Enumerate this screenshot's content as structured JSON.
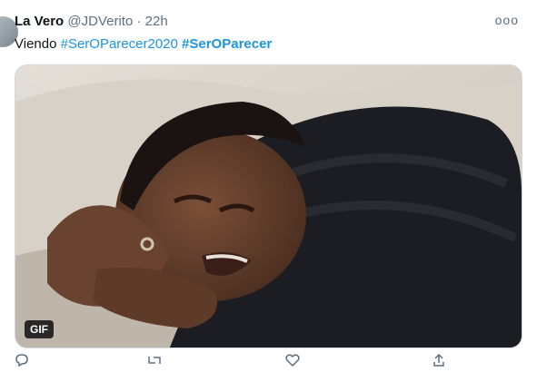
{
  "tweet": {
    "display_name": "La Vero",
    "handle": "@JDVerito",
    "separator": "·",
    "time": "22h",
    "more_label": "ooo",
    "text_prefix": "Viendo ",
    "hashtags": [
      "#SerOParecer2020",
      "#SerOParecer"
    ]
  },
  "media": {
    "badge": "GIF",
    "icon": "gif-image"
  },
  "actions": [
    {
      "icon": "reply-icon"
    },
    {
      "icon": "retweet-icon"
    },
    {
      "icon": "like-icon"
    },
    {
      "icon": "share-icon"
    }
  ],
  "colors": {
    "accent": "#1b95e0",
    "text": "#0f1419",
    "muted": "#5b7083"
  }
}
